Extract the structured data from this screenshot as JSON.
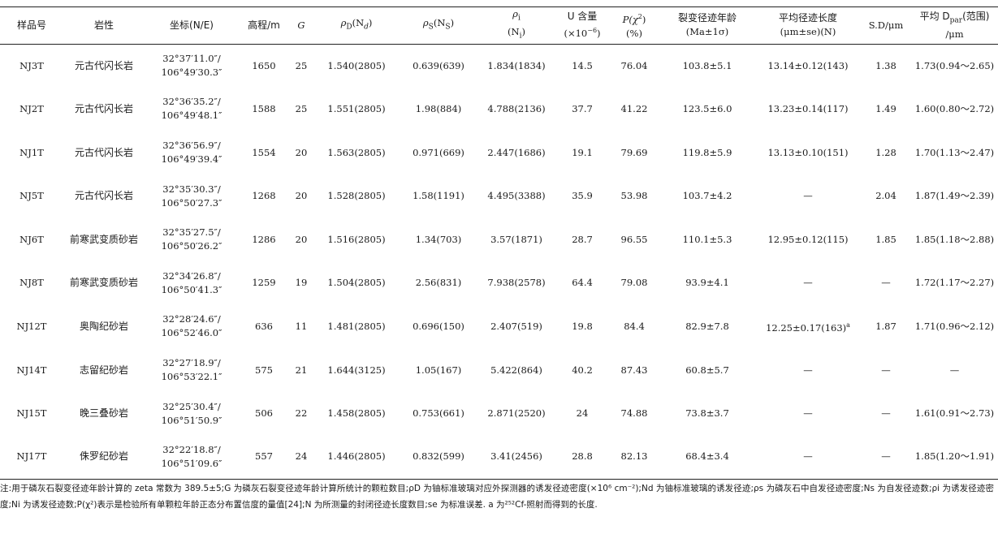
{
  "table": {
    "headers": {
      "sample": "样品号",
      "lithology": "岩性",
      "coord": "坐标(N/E)",
      "elev": "高程/m",
      "g": "G",
      "rho_d": "ρ",
      "rho_d_sub": "D",
      "rho_d_tail": "(N",
      "rho_d_n": "d",
      "rho_d_close": ")",
      "rho_s": "ρ",
      "rho_s_sub": "S",
      "rho_s_tail": "(N",
      "rho_s_n": "S",
      "rho_s_close": ")",
      "rho_i_line1": "ρ",
      "rho_i_sub": "i",
      "rho_i_line2": "(N",
      "rho_i_n": "i",
      "rho_i_close": ")",
      "u_line1": "U 含量",
      "u_line2": "(×10",
      "u_exp": "−6",
      "u_close": ")",
      "p_line1": "P(χ",
      "p_exp": "2",
      "p_close": ")",
      "p_line2": "(%)",
      "age_line1": "裂变径迹年龄",
      "age_line2": "(Ma±1σ)",
      "len_line1": "平均径迹长度",
      "len_line2": "(μm±se)(N)",
      "sd": "S.D/μm",
      "dpar_line1": "平均 D",
      "dpar_sub": "par",
      "dpar_tail": "(范围)",
      "dpar_line2": "/μm"
    },
    "rows": [
      {
        "sample": "NJ3T",
        "lithology": "元古代闪长岩",
        "lat": "32°37′11.0″/",
        "lon": "106°49′30.3″",
        "elev": "1650",
        "g": "25",
        "rho_d": "1.540(2805)",
        "rho_s": "0.639(639)",
        "rho_i": "1.834(1834)",
        "u": "14.5",
        "p": "76.04",
        "age": "103.8±5.1",
        "len": "13.14±0.12(143)",
        "sd": "1.38",
        "dpar": "1.73(0.94～2.65)"
      },
      {
        "sample": "NJ2T",
        "lithology": "元古代闪长岩",
        "lat": "32°36′35.2″/",
        "lon": "106°49′48.1″",
        "elev": "1588",
        "g": "25",
        "rho_d": "1.551(2805)",
        "rho_s": "1.98(884)",
        "rho_i": "4.788(2136)",
        "u": "37.7",
        "p": "41.22",
        "age": "123.5±6.0",
        "len": "13.23±0.14(117)",
        "sd": "1.49",
        "dpar": "1.60(0.80～2.72)"
      },
      {
        "sample": "NJ1T",
        "lithology": "元古代闪长岩",
        "lat": "32°36′56.9″/",
        "lon": "106°49′39.4″",
        "elev": "1554",
        "g": "20",
        "rho_d": "1.563(2805)",
        "rho_s": "0.971(669)",
        "rho_i": "2.447(1686)",
        "u": "19.1",
        "p": "79.69",
        "age": "119.8±5.9",
        "len": "13.13±0.10(151)",
        "sd": "1.28",
        "dpar": "1.70(1.13～2.47)"
      },
      {
        "sample": "NJ5T",
        "lithology": "元古代闪长岩",
        "lat": "32°35′30.3″/",
        "lon": "106°50′27.3″",
        "elev": "1268",
        "g": "20",
        "rho_d": "1.528(2805)",
        "rho_s": "1.58(1191)",
        "rho_i": "4.495(3388)",
        "u": "35.9",
        "p": "53.98",
        "age": "103.7±4.2",
        "len": "—",
        "sd": "2.04",
        "dpar": "1.87(1.49～2.39)"
      },
      {
        "sample": "NJ6T",
        "lithology": "前寒武变质砂岩",
        "lat": "32°35′27.5″/",
        "lon": "106°50′26.2″",
        "elev": "1286",
        "g": "20",
        "rho_d": "1.516(2805)",
        "rho_s": "1.34(703)",
        "rho_i": "3.57(1871)",
        "u": "28.7",
        "p": "96.55",
        "age": "110.1±5.3",
        "len": "12.95±0.12(115)",
        "sd": "1.85",
        "dpar": "1.85(1.18～2.88)"
      },
      {
        "sample": "NJ8T",
        "lithology": "前寒武变质砂岩",
        "lat": "32°34′26.8″/",
        "lon": "106°50′41.3″",
        "elev": "1259",
        "g": "19",
        "rho_d": "1.504(2805)",
        "rho_s": "2.56(831)",
        "rho_i": "7.938(2578)",
        "u": "64.4",
        "p": "79.08",
        "age": "93.9±4.1",
        "len": "—",
        "sd": "—",
        "dpar": "1.72(1.17～2.27)"
      },
      {
        "sample": "NJ12T",
        "lithology": "奥陶纪砂岩",
        "lat": "32°28′24.6″/",
        "lon": "106°52′46.0″",
        "elev": "636",
        "g": "11",
        "rho_d": "1.481(2805)",
        "rho_s": "0.696(150)",
        "rho_i": "2.407(519)",
        "u": "19.8",
        "p": "84.4",
        "age": "82.9±7.8",
        "len": "12.25±0.17(163)",
        "len_sup": "a",
        "sd": "1.87",
        "dpar": "1.71(0.96～2.12)"
      },
      {
        "sample": "NJ14T",
        "lithology": "志留纪砂岩",
        "lat": "32°27′18.9″/",
        "lon": "106°53′22.1″",
        "elev": "575",
        "g": "21",
        "rho_d": "1.644(3125)",
        "rho_s": "1.05(167)",
        "rho_i": "5.422(864)",
        "u": "40.2",
        "p": "87.43",
        "age": "60.8±5.7",
        "len": "—",
        "sd": "—",
        "dpar": "—"
      },
      {
        "sample": "NJ15T",
        "lithology": "晚三叠砂岩",
        "lat": "32°25′30.4″/",
        "lon": "106°51′50.9″",
        "elev": "506",
        "g": "22",
        "rho_d": "1.458(2805)",
        "rho_s": "0.753(661)",
        "rho_i": "2.871(2520)",
        "u": "24",
        "p": "74.88",
        "age": "73.8±3.7",
        "len": "—",
        "sd": "—",
        "dpar": "1.61(0.91～2.73)"
      },
      {
        "sample": "NJ17T",
        "lithology": "侏罗纪砂岩",
        "lat": "32°22′18.8″/",
        "lon": "106°51′09.6″",
        "elev": "557",
        "g": "24",
        "rho_d": "1.446(2805)",
        "rho_s": "0.832(599)",
        "rho_i": "3.41(2456)",
        "u": "28.8",
        "p": "82.13",
        "age": "68.4±3.4",
        "len": "—",
        "sd": "—",
        "dpar": "1.85(1.20～1.91)"
      }
    ]
  },
  "note": {
    "text": "注:用于磷灰石裂变径迹年龄计算的 zeta 常数为 389.5±5;G 为磷灰石裂变径迹年龄计算所统计的颗粒数目;ρD 为铀标准玻璃对应外探测器的诱发径迹密度(×10⁶ cm⁻²);Nd 为铀标准玻璃的诱发径迹;ρs 为磷灰石中自发径迹密度;Ns 为自发径迹数;ρi 为诱发径迹密度;Ni 为诱发径迹数;P(χ²)表示是检验所有单颗粒年龄正态分布置信度的量值[24];N 为所测量的封闭径迹长度数目;se 为标准误差. a 为²⁵²Cf-照射而得到的长度."
  }
}
